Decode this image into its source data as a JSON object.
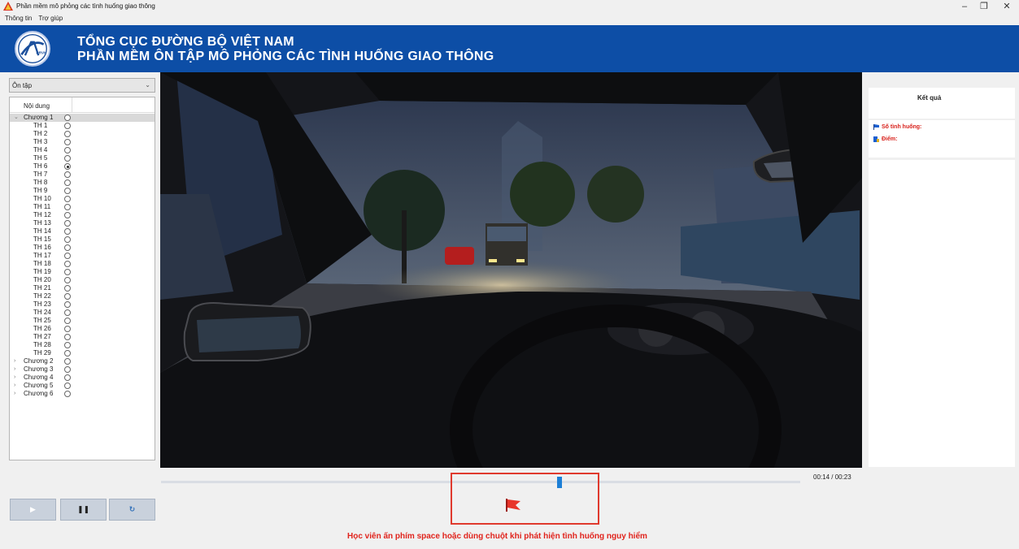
{
  "window": {
    "title": "Phần mềm mô phỏng các tình huống giao thông",
    "minimize_glyph": "–",
    "restore_glyph": "❐",
    "close_glyph": "✕"
  },
  "menu": [
    "Thông tin",
    "Trợ giúp"
  ],
  "banner": {
    "line1": "TỔNG CỤC ĐƯỜNG BỘ VIỆT NAM",
    "line2": "PHẦN MỀM ÔN TẬP MÔ PHỎNG CÁC TÌNH HUỐNG GIAO THÔNG",
    "logo_text": "DRVN",
    "color": "#0d4ea6"
  },
  "mode_select": {
    "value": "Ôn tập"
  },
  "tree": {
    "header": "Nội dung",
    "chapter1": {
      "label": "Chương 1",
      "expanded": true
    },
    "situations": [
      "TH 1",
      "TH 2",
      "TH 3",
      "TH 4",
      "TH 5",
      "TH 6",
      "TH 7",
      "TH 8",
      "TH 9",
      "TH 10",
      "TH 11",
      "TH 12",
      "TH 13",
      "TH 14",
      "TH 15",
      "TH 16",
      "TH 17",
      "TH 18",
      "TH 19",
      "TH 20",
      "TH 21",
      "TH 22",
      "TH 23",
      "TH 24",
      "TH 25",
      "TH 26",
      "TH 27",
      "TH 28",
      "TH 29"
    ],
    "selected_situation": "TH 6",
    "collapsed_chapters": [
      "Chương 2",
      "Chương 3",
      "Chương 4",
      "Chương 5",
      "Chương 6"
    ]
  },
  "controls": {
    "play_icon": "▶",
    "pause_icon": "❚❚",
    "reload_icon": "↻"
  },
  "player": {
    "time": "00:14 / 00:23",
    "progress_fraction": 0.62
  },
  "hint": "Học viên ấn phím space hoặc dùng chuột khi phát hiện tình huống nguy hiểm",
  "results": {
    "title": "Kết quả",
    "situations_label": "Số tình huống:",
    "score_label": "Điểm:"
  },
  "colors": {
    "accent_red": "#e0231c",
    "timeline_blue": "#1c7fd6"
  }
}
